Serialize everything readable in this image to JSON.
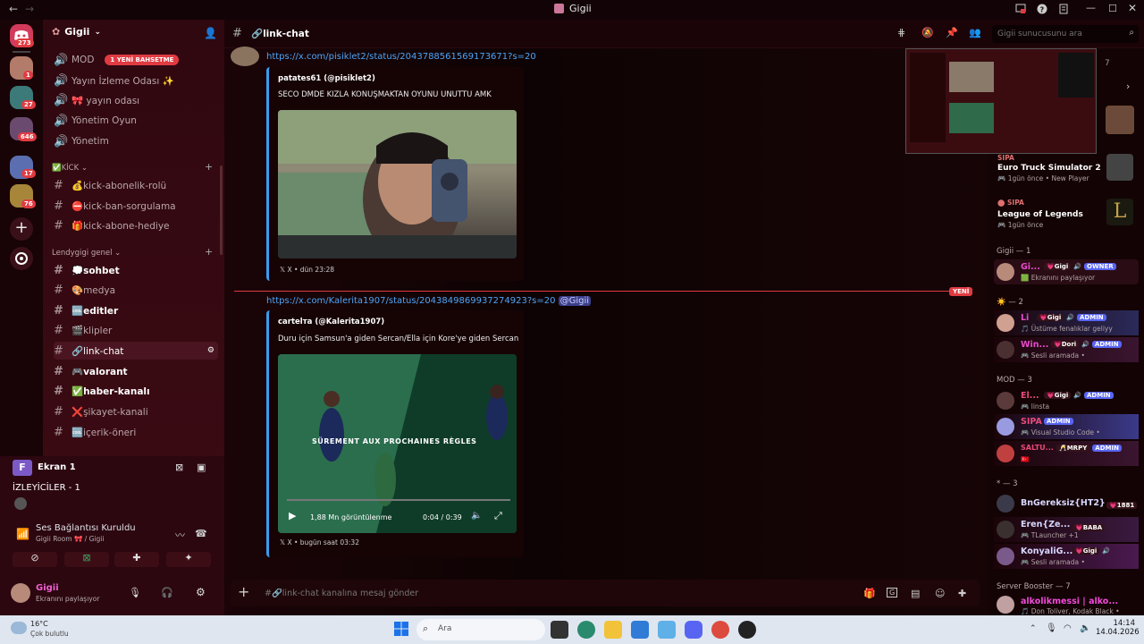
{
  "window": {
    "title": "Gigii"
  },
  "rail": {
    "home_badge": "273",
    "badges": [
      "1",
      "27",
      "646",
      "17",
      "76"
    ]
  },
  "server": {
    "name": "Gigii"
  },
  "channels_top": [
    {
      "name": "MOD",
      "pill": "1 YENİ BAHSETME"
    },
    {
      "name": "Yayın İzleme Odası ✨"
    },
    {
      "name": "🎀 yayın odası"
    },
    {
      "name": "Yönetim Oyun"
    },
    {
      "name": "Yönetim"
    }
  ],
  "categories": {
    "kick": "✅KİCK",
    "general": "Lendygigi genel"
  },
  "kick_channels": [
    "💰kick-abonelik-rolü",
    "⛔kick-ban-sorgulama",
    "🎁kick-abone-hediye"
  ],
  "general_channels": [
    "💭sohbet",
    "🎨medya",
    "🆒editler",
    "🎬klipler",
    "🔗link-chat",
    "🎮valorant",
    "✅haber-kanalı",
    "❌şikayet-kanali",
    "🆒içerik-öneri"
  ],
  "stream": {
    "name": "Ekran 1",
    "viewers": "İZLEYİCİLER - 1"
  },
  "voice": {
    "status": "Ses Bağlantısı Kuruldu",
    "room": "Gigii Room 🎀 / Gigii"
  },
  "user": {
    "name": "Gigii",
    "status": "Ekranını paylaşıyor"
  },
  "header": {
    "channel": "🔗link-chat",
    "search_placeholder": "Gigii sunucusunu ara"
  },
  "messages": [
    {
      "link": "https://x.com/pisiklet2/status/2043788561569173671?s=20",
      "author": "patates61 (@pisiklet2)",
      "text": "SECO DMDE KIZLA KONUŞMAKTAN OYUNU UNUTTU AMK",
      "footer": "X • dün 23:28"
    },
    {
      "link": "https://x.com/Kalerita1907/status/2043849869937274923?s=20",
      "mention": "@Gigii",
      "author": "cartelта (@Kalerita1907)",
      "text": "Duru için Samsun'a giden Sercan/Ella için Kore'ye giden Sercan",
      "footer": "X • bugün saat 03:32",
      "video": {
        "overlay": "SÜREMENT AUX PROCHAINES RÈGLES",
        "views": "1,88 Mn görüntülenme",
        "time": "0:04 / 0:39"
      }
    }
  ],
  "new_label": "YENİ",
  "composer": {
    "placeholder": "#🔗link-chat kanalına mesaj gönder"
  },
  "activities": [
    {
      "by": "SIPA",
      "game": "Euro Truck Simulator 2",
      "ago": "1gün önce",
      "extra": "New Player"
    },
    {
      "by": "SIPA",
      "game": "League of Legends",
      "ago": "1gün önce"
    }
  ],
  "member_groups": [
    {
      "title": "Gigii — 1",
      "members": [
        {
          "name": "Gi...",
          "tags": [
            "💗Gigi",
            "OWNER"
          ],
          "sub": "Ekranını paylaşıyor",
          "color": "#e84acb"
        }
      ]
    },
    {
      "title": "☀️ — 2",
      "members": [
        {
          "name": "Li",
          "tags": [
            "💗Gigi",
            "ADMIN"
          ],
          "sub": "Üstüme fenalıklar geliyy",
          "color": "#e84acb"
        },
        {
          "name": "Win...",
          "tags": [
            "💗Dori",
            "ADMIN"
          ],
          "sub": "Sesli aramada •",
          "color": "#e84acb"
        }
      ]
    },
    {
      "title": "MOD — 3",
      "members": [
        {
          "name": "El...",
          "tags": [
            "💗Gigi",
            "ADMIN"
          ],
          "sub": "linsta",
          "color": "#e84a7a"
        },
        {
          "name": "SIPA",
          "tags": [
            "ADMIN"
          ],
          "sub": "Visual Studio Code •",
          "color": "#e84a7a"
        },
        {
          "name": "SALTU...",
          "tags": [
            "🥂MRPY",
            "ADMIN"
          ],
          "sub": "",
          "color": "#e84a7a"
        }
      ]
    },
    {
      "title": "* — 3",
      "members": [
        {
          "name": "BnGereksiz{HT2}",
          "tags": [
            "💗1881"
          ],
          "sub": "",
          "color": "#d7d7ff"
        },
        {
          "name": "Eren{Ze...",
          "tags": [
            "💗BABA"
          ],
          "sub": "TLauncher +1",
          "color": "#d7d7ff"
        },
        {
          "name": "KonyaliG...",
          "tags": [
            "💗Gigi"
          ],
          "sub": "Sesli aramada •",
          "color": "#d7d7ff"
        }
      ]
    },
    {
      "title": "Server Booster — 7",
      "members": [
        {
          "name": "alkolikmessi | alko...",
          "tags": [],
          "sub": "Don Toliver, Kodak Black •",
          "color": "#f24adc"
        }
      ]
    }
  ],
  "taskbar": {
    "weather_temp": "16°C",
    "weather_desc": "Çok bulutlu",
    "search": "Ara",
    "time": "14:14",
    "date": "14.04.2026"
  }
}
